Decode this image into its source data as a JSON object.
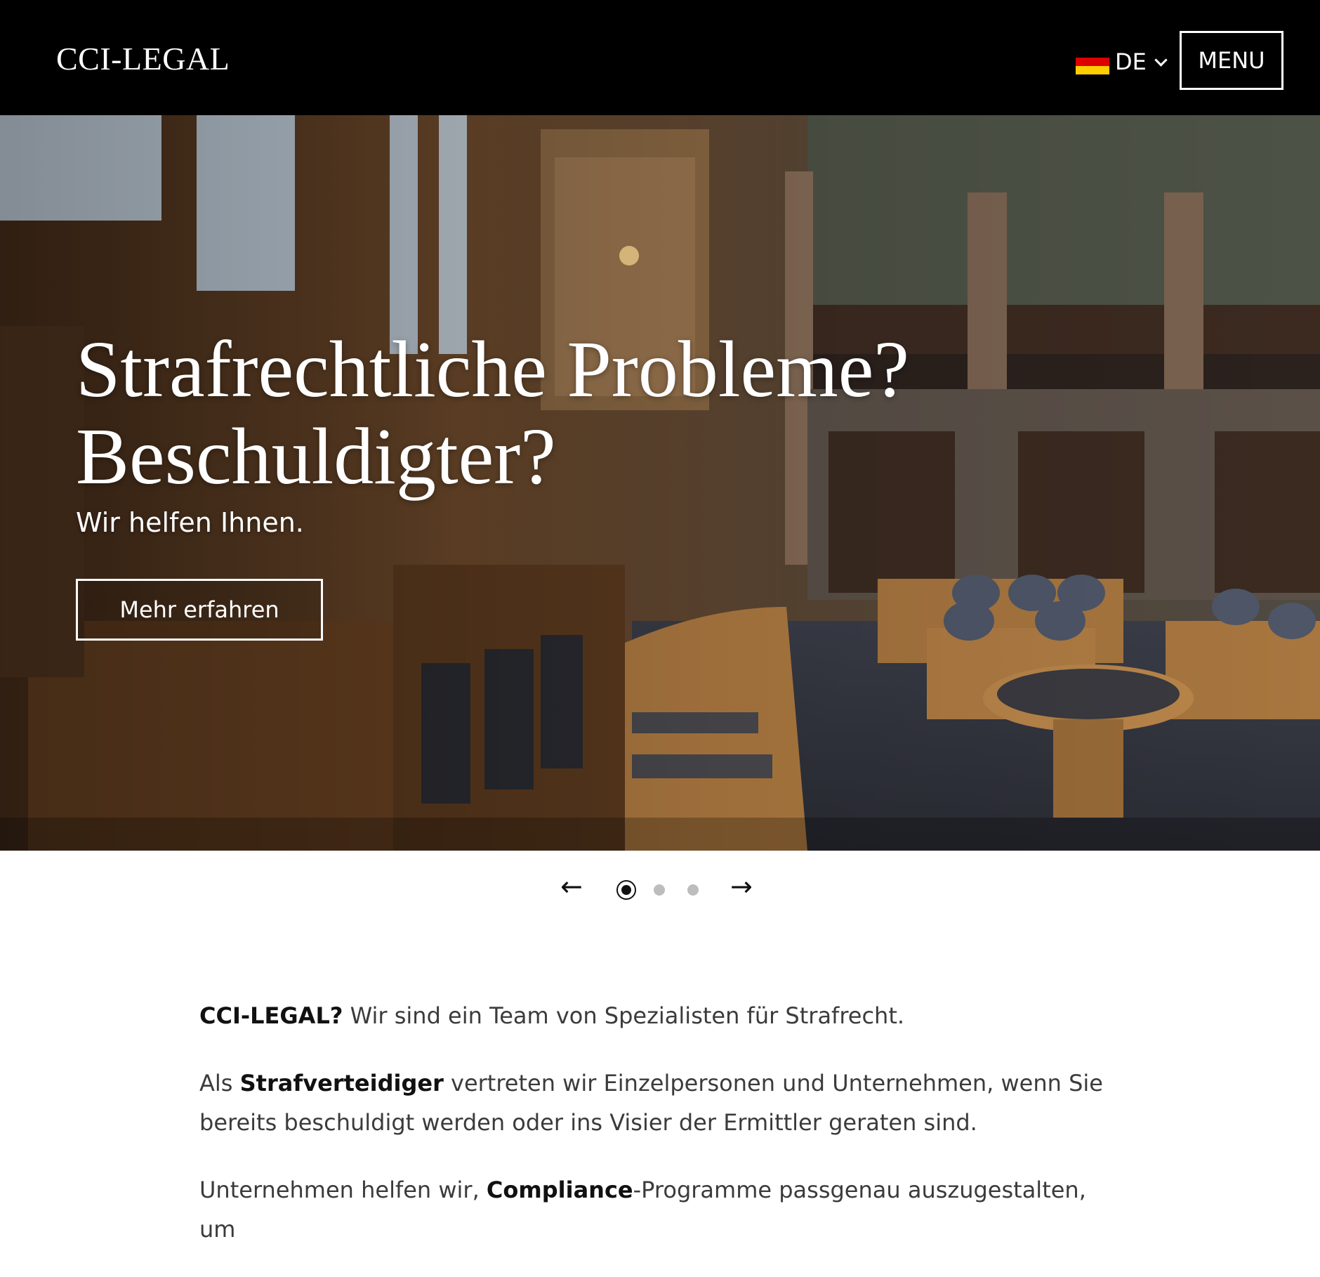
{
  "header": {
    "logo": "CCI-LEGAL",
    "language": "DE",
    "menu_label": "MENU"
  },
  "hero": {
    "title_line1": "Strafrechtliche Probleme?",
    "title_line2": "Beschuldigter?",
    "subtitle": "Wir helfen Ihnen.",
    "button_label": "Mehr erfahren"
  },
  "carousel": {
    "prev": "←",
    "next": "→",
    "active_slide": 1,
    "slide_count": 3
  },
  "content": {
    "p1_bold": "CCI-LEGAL?",
    "p1_text": " Wir sind ein Team von Spezialisten für Strafrecht.",
    "p2_pre": "Als ",
    "p2_bold": "Strafverteidiger",
    "p2_text": " vertreten wir Einzelpersonen und Unternehmen, wenn Sie bereits beschuldigt werden oder ins Visier der Ermittler geraten sind.",
    "p3_pre": "Unternehmen helfen wir, ",
    "p3_bold": "Compliance",
    "p3_text": "-Programme passgenau auszugestalten, um"
  },
  "colors": {
    "header_bg": "#000000",
    "text": "#3b3b3b",
    "flag": [
      "#000000",
      "#dd0000",
      "#ffce00"
    ]
  },
  "icons": [
    "flag-de-icon",
    "chevron-down-icon",
    "arrow-left-icon",
    "arrow-right-icon"
  ]
}
